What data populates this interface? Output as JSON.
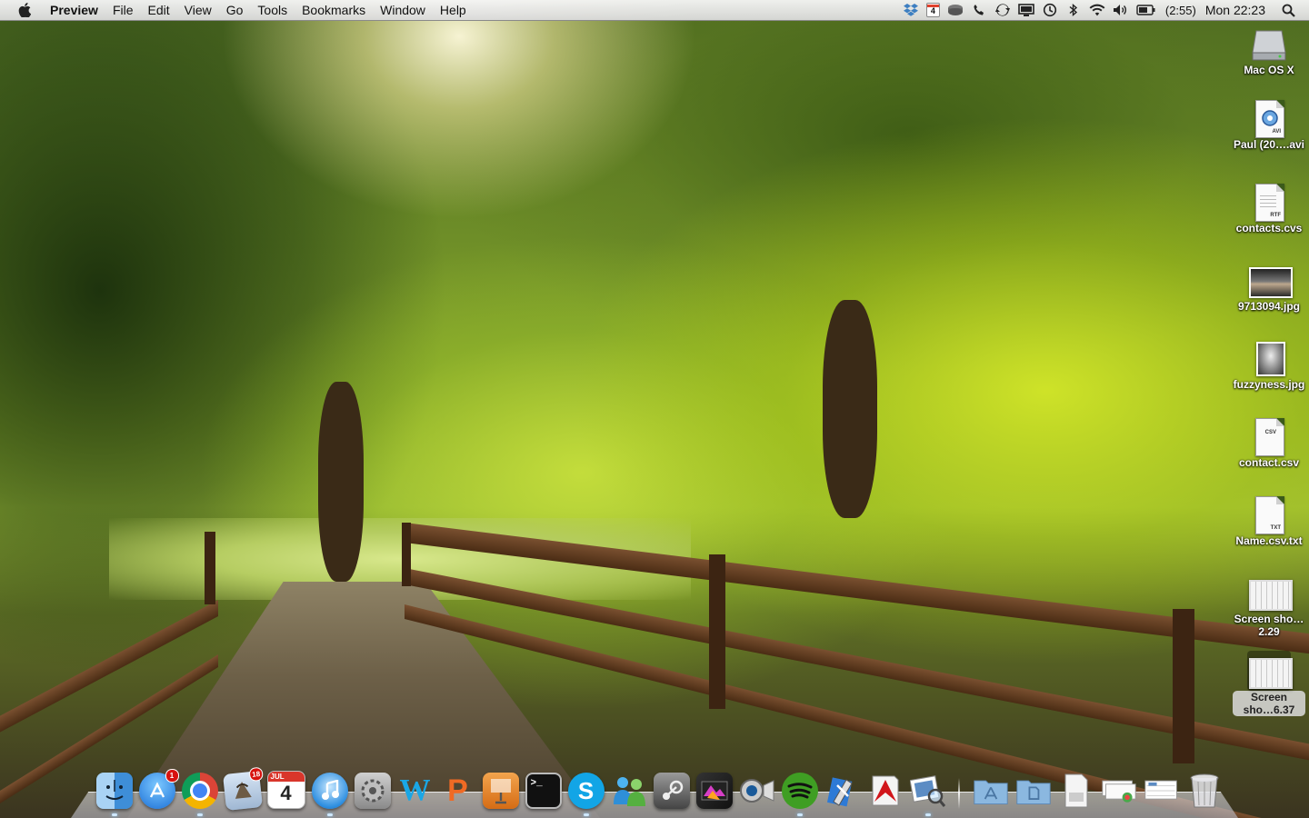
{
  "menubar": {
    "app_name": "Preview",
    "menus": [
      "File",
      "Edit",
      "View",
      "Go",
      "Tools",
      "Bookmarks",
      "Window",
      "Help"
    ],
    "status": {
      "calendar_day": "4",
      "battery_time": "(2:55)",
      "clock": "Mon 22:23",
      "icons": [
        "dropbox-icon",
        "calendar-icon",
        "drive-icon",
        "phone-icon",
        "sync-icon",
        "display-icon",
        "time-machine-icon",
        "bluetooth-icon",
        "wifi-icon",
        "volume-icon",
        "battery-icon",
        "spotlight-icon"
      ]
    }
  },
  "desktop": {
    "icons": [
      {
        "label": "Mac OS X",
        "kind": "hard-drive-icon"
      },
      {
        "label": "Paul (20….avi",
        "kind": "avi-file-icon",
        "tag": "AVI"
      },
      {
        "label": "contacts.cvs",
        "kind": "rtf-file-icon",
        "tag": "RTF"
      },
      {
        "label": "9713094.jpg",
        "kind": "jpg-file-icon"
      },
      {
        "label": "fuzzyness.jpg",
        "kind": "jpg-file-icon"
      },
      {
        "label": "contact.csv",
        "kind": "csv-file-icon",
        "tag": "CSV"
      },
      {
        "label": "Name.csv.txt",
        "kind": "txt-file-icon",
        "tag": "TXT"
      },
      {
        "label": "Screen sho…2.29",
        "kind": "screenshot-file-icon"
      },
      {
        "label": "Screen sho…6.37",
        "kind": "screenshot-file-icon",
        "selected": true
      }
    ]
  },
  "dock": {
    "apps": [
      {
        "name": "finder-icon"
      },
      {
        "name": "app-store-icon",
        "badge": "1"
      },
      {
        "name": "chrome-icon"
      },
      {
        "name": "mail-icon",
        "badge": "18"
      },
      {
        "name": "calendar-icon",
        "month": "JUL",
        "day": "4"
      },
      {
        "name": "itunes-icon"
      },
      {
        "name": "system-preferences-icon"
      },
      {
        "name": "word-icon",
        "glyph": "W"
      },
      {
        "name": "powerpoint-icon",
        "glyph": "P"
      },
      {
        "name": "keynote-icon"
      },
      {
        "name": "terminal-icon",
        "glyph": ">_"
      },
      {
        "name": "skype-icon",
        "glyph": "S"
      },
      {
        "name": "ichat-icon"
      },
      {
        "name": "steam-icon"
      },
      {
        "name": "final-cut-icon"
      },
      {
        "name": "facetime-camera-icon"
      },
      {
        "name": "spotify-icon"
      },
      {
        "name": "xcode-icon"
      },
      {
        "name": "acrobat-icon"
      },
      {
        "name": "preview-icon"
      }
    ],
    "stacks": [
      {
        "name": "applications-folder-icon"
      },
      {
        "name": "documents-folder-icon"
      },
      {
        "name": "file-stack-icon"
      },
      {
        "name": "downloads-stack-icon"
      },
      {
        "name": "screenshot-stack-icon"
      },
      {
        "name": "trash-icon"
      }
    ]
  }
}
